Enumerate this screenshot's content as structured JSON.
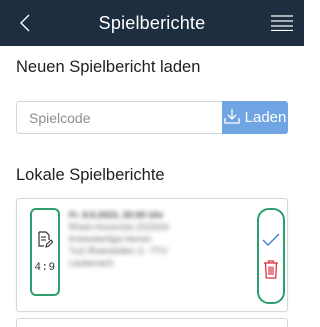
{
  "header": {
    "title": "Spielberichte",
    "back_icon": "chevron-left-icon",
    "menu_icon": "hamburger-menu-icon",
    "background": "#1d2e40"
  },
  "load_section": {
    "title": "Neuen Spielbericht laden",
    "code_input": {
      "placeholder": "Spielcode",
      "value": ""
    },
    "load_button": {
      "label": "Laden",
      "icon": "download-icon",
      "color": "#6fa5e3"
    }
  },
  "local_section": {
    "title": "Lokale Spielberichte",
    "reports": [
      {
        "score": "4:9",
        "icon": "document-edit-icon",
        "details": [
          "Fr. 8.9.2023, 20:00 Uhr",
          "Rhein-Hunsrück 2023/24",
          "Kreisoberliga Herren",
          "TuS Rheinböllen 3 - TTV",
          "Laubenach"
        ],
        "actions": {
          "confirm_icon": "checkmark-icon",
          "delete_icon": "trash-icon",
          "delete_color": "#d9363e"
        }
      }
    ]
  },
  "colors": {
    "highlight_outline": "#2e9e6e"
  }
}
